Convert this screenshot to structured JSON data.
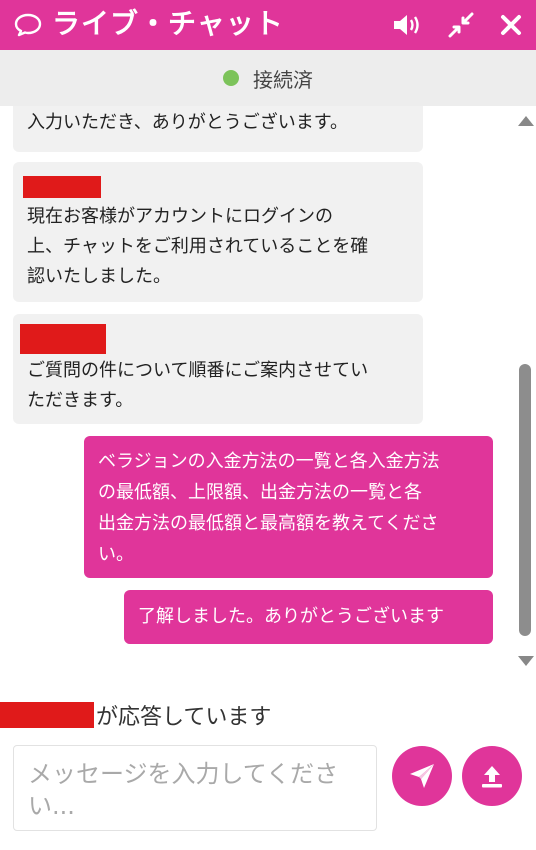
{
  "header": {
    "title": "ライブ・チャット",
    "icons": [
      "chat-bubble-icon",
      "speaker-icon",
      "minimize-icon",
      "close-icon"
    ],
    "background": "#e0359a"
  },
  "status": {
    "text": "接続済",
    "dot_color": "#7cc35a"
  },
  "messages": [
    {
      "from": "agent",
      "sender_redacted": false,
      "lines": [
        "入力いただき、ありがとうございます。"
      ]
    },
    {
      "from": "agent",
      "sender_redacted": true,
      "lines": [
        "現在お客様がアカウントにログインの",
        "上、チャットをご利用されていることを確",
        "認いたしました。"
      ]
    },
    {
      "from": "agent",
      "sender_redacted": true,
      "lines": [
        "ご質問の件について順番にご案内させてい",
        "ただきます。"
      ]
    },
    {
      "from": "user",
      "lines": [
        "ベラジョンの入金方法の一覧と各入金方法",
        "の最低額、上限額、出金方法の一覧と各",
        "出金方法の最低額と最高額を教えてくださ",
        "い。"
      ]
    },
    {
      "from": "user",
      "lines": [
        "了解しました。ありがとうございます"
      ]
    }
  ],
  "typing": {
    "text": "が応答しています",
    "sender_redacted": true
  },
  "input": {
    "placeholder_lines": [
      "メッセージを入力してくださ",
      "い..."
    ]
  },
  "buttons": {
    "send": "send-icon",
    "upload": "upload-icon"
  },
  "colors": {
    "accent": "#e0359a",
    "redaction": "#e01a1a",
    "agent_bubble": "#f1f1f1"
  }
}
